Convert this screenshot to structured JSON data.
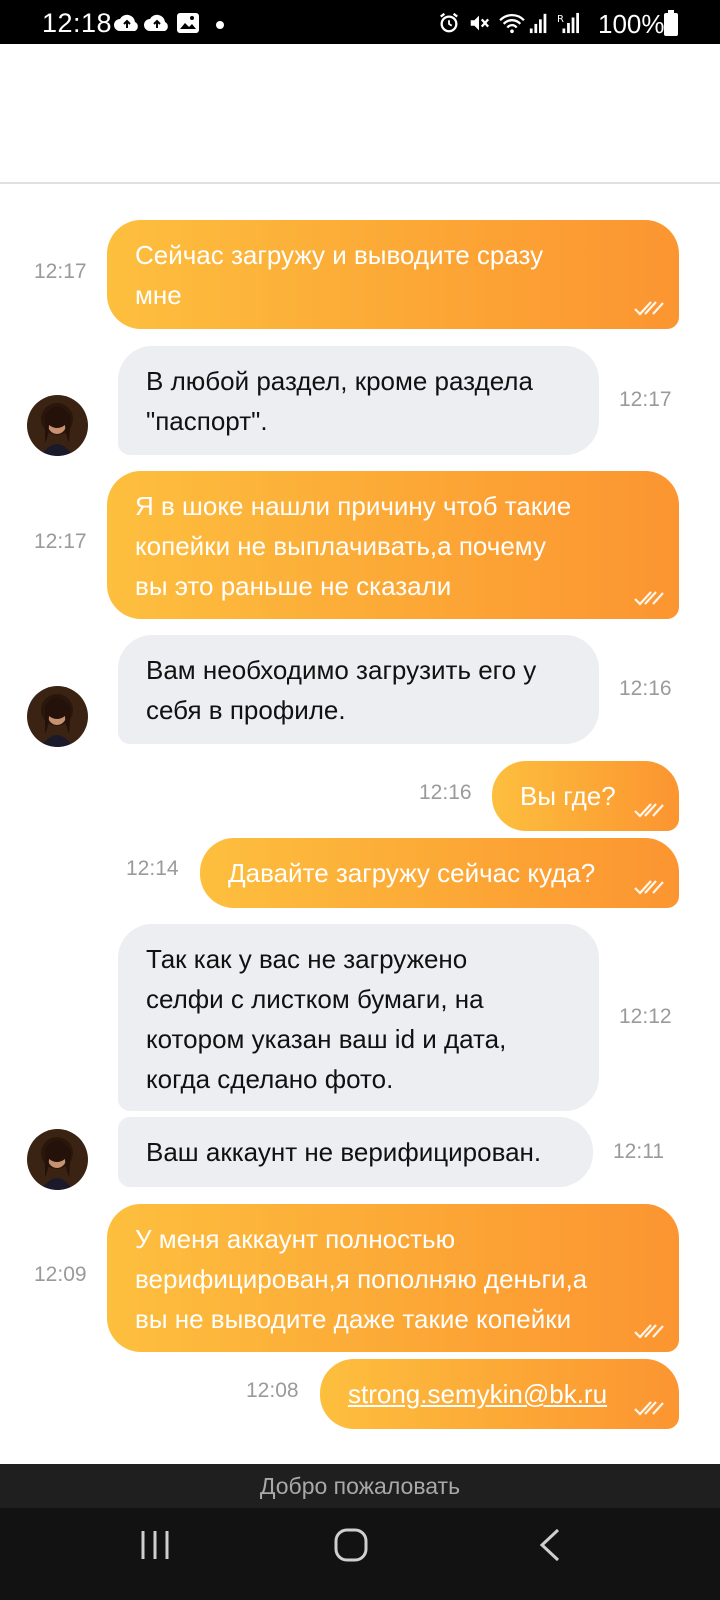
{
  "status_bar": {
    "time": "12:18",
    "battery": "100%",
    "icons": [
      "cloud-icon",
      "cloud-icon",
      "image-icon",
      "dot-icon",
      "alarm-icon",
      "mute-icon",
      "wifi-icon",
      "signal-icon",
      "signal-r-icon",
      "battery-icon"
    ]
  },
  "footer": {
    "welcome": "Добро пожаловать"
  },
  "colors": {
    "outgoing_start": "#fdbf3e",
    "outgoing_end": "#fb9531",
    "incoming_bg": "#edeef2",
    "timestamp": "#9a9a9a"
  },
  "messages": [
    {
      "dir": "out",
      "time": "12:17",
      "text": "Сейчас загружу и выводите сразу\nмне"
    },
    {
      "dir": "in",
      "time": "12:17",
      "text": "В любой раздел, кроме раздела\n\"паспорт\"."
    },
    {
      "dir": "out",
      "time": "12:17",
      "text": "Я в шоке нашли причину чтоб такие\nкопейки не выплачивать,а почему\nвы это раньше не сказали"
    },
    {
      "dir": "in",
      "time": "12:16",
      "text": "Вам необходимо загрузить его у\nсебя в профиле."
    },
    {
      "dir": "out",
      "time": "12:16",
      "text": "Вы где?"
    },
    {
      "dir": "out",
      "time": "12:14",
      "text": "Давайте загружу сейчас куда?"
    },
    {
      "dir": "in",
      "time": "12:12",
      "text": "Так как у вас не загружено\nселфи с листком бумаги, на\nкотором указан ваш id и дата,\nкогда сделано фото."
    },
    {
      "dir": "in",
      "time": "12:11",
      "text": "Ваш аккаунт не верифицирован."
    },
    {
      "dir": "out",
      "time": "12:09",
      "text": "У меня аккаунт полностью\nверифицирован,я пополняю деньги,а\nвы не выводите даже такие копейки"
    },
    {
      "dir": "out",
      "time": "12:08",
      "text": "strong.semykin@bk.ru"
    }
  ]
}
